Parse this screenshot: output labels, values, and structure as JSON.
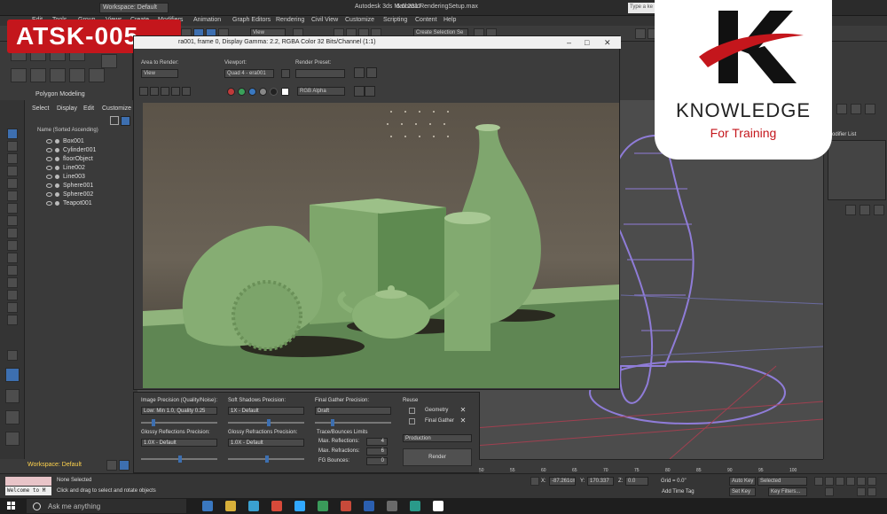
{
  "title_bar": {
    "workspace": "Workspace: Default",
    "app_title": "Autodesk 3ds Max 2017",
    "file_name": "6.6basicRenderingSetup.max",
    "search_placeholder": "Type a ke"
  },
  "menu": [
    "Edit",
    "Tools",
    "Group",
    "Views",
    "Create",
    "Modifiers",
    "Animation",
    "Graph Editors",
    "Rendering",
    "Civil View",
    "Customize",
    "Scripting",
    "Content",
    "Help"
  ],
  "toolbar": {
    "view_dropdown": "View",
    "selection_set": "Create Selection Se"
  },
  "overlay_badge": "ATSK-005",
  "ribbon": {
    "label": "Polygon Modeling"
  },
  "scene_explorer": {
    "menu": [
      "Select",
      "Display",
      "Edit",
      "Customize"
    ],
    "column_header": "Name (Sorted Ascending)",
    "objects": [
      "Box001",
      "Cylinder001",
      "floorObject",
      "Line002",
      "Line003",
      "Sphere001",
      "Sphere002",
      "Teapot001"
    ]
  },
  "render_frame": {
    "title": "ra001, frame 0, Display Gamma: 2.2, RGBA Color 32 Bits/Channel (1:1)",
    "area_label": "Area to Render:",
    "area_value": "View",
    "viewport_label": "Viewport:",
    "viewport_value": "Quad 4 - era001",
    "preset_label": "Render Preset:",
    "preset_value": "",
    "channel_value": "RGB Alpha",
    "colors": {
      "ball": "#7fa66e",
      "dot_red": "#c03a3a",
      "dot_green": "#3aa05a",
      "dot_blue": "#3a78c0"
    }
  },
  "render_settings": {
    "image_precision_label": "Image Precision (Quality/Noise):",
    "image_precision_value": "Low: Min 1.0, Quality 0.25",
    "soft_shadows_label": "Soft Shadows Precision:",
    "soft_shadows_value": "1X - Default",
    "final_gather_label": "Final Gather Precision:",
    "final_gather_value": "Draft",
    "glossy_reflections_label": "Glossy Reflections Precision:",
    "glossy_reflections_value": "1.0X - Default",
    "glossy_refractions_label": "Glossy Refractions Precision:",
    "glossy_refractions_value": "1.0X - Default",
    "trace_label": "Trace/Bounces Limits",
    "max_reflections_label": "Max. Reflections:",
    "max_reflections_value": "4",
    "max_refractions_label": "Max. Refractions:",
    "max_refractions_value": "6",
    "fg_bounces_label": "FG Bounces:",
    "fg_bounces_value": "0",
    "reuse_label": "Reuse",
    "reuse_geometry": "Geometry",
    "reuse_final_gather": "Final Gather",
    "mode_value": "Production",
    "render_button": "Render"
  },
  "right_panel": {
    "modifier_list": "Modifier List"
  },
  "timeline": {
    "ticks": [
      "50",
      "55",
      "60",
      "65",
      "70",
      "75",
      "80",
      "85",
      "90",
      "95",
      "100"
    ]
  },
  "workspace_bar": {
    "label": "Workspace: Default"
  },
  "status": {
    "welcome": "Welcome to M",
    "none_selected": "None Selected",
    "hint": "Click and drag to select and rotate objects",
    "x_label": "X:",
    "x_value": "-87.261cm",
    "y_label": "Y:",
    "y_value": "170.337",
    "z_label": "Z:",
    "z_value": "0.0",
    "grid": "Grid = 0.0\"",
    "add_time_tag": "Add Time Tag",
    "auto_key": "Auto Key",
    "selected": "Selected",
    "set_key": "Set Key",
    "key_filters": "Key Filters..."
  },
  "taskbar": {
    "search_text": "Ask me anything",
    "app_colors": [
      "#3a78c0",
      "#d8b03a",
      "#3aa0d0",
      "#d84a3a",
      "#31a8ff",
      "#3a9a5a",
      "#c84a3a",
      "#2b5fb0",
      "#6a6a6a",
      "#2a9a8a",
      "#ffffff"
    ]
  },
  "brand": {
    "name": "KNOWLEDGE",
    "tagline": "For Training",
    "letter": "K"
  }
}
